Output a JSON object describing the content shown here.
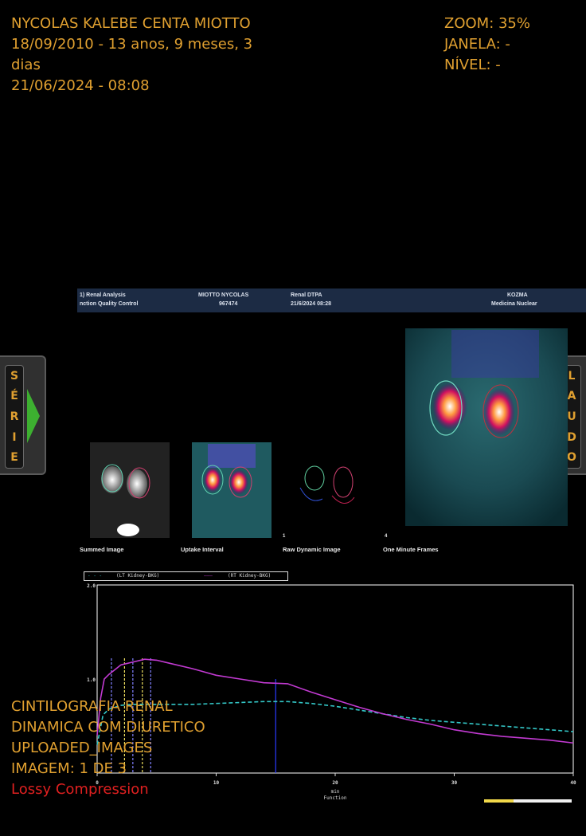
{
  "overlay": {
    "top_left": {
      "name": "NYCOLAS KALEBE CENTA MIOTTO",
      "birth": "18/09/2010 - 13 anos, 9 meses, 3 dias",
      "study_datetime": "21/06/2024 - 08:08"
    },
    "top_right": {
      "zoom": "ZOOM: 35%",
      "window": "JANELA: -",
      "level": "NÍVEL: -"
    },
    "bottom_left": {
      "line1": "CINTILOGRAFIA RENAL",
      "line2": "DINAMICA COM DIURETICO",
      "line3": "UPLOADED_IMAGES",
      "line4": "IMAGEM: 1 DE 3",
      "compression": "Lossy Compression"
    }
  },
  "side_buttons": {
    "left": {
      "letters": [
        "S",
        "É",
        "R",
        "I",
        "E"
      ],
      "icon": "arrow-right-icon"
    },
    "right": {
      "letters": [
        "L",
        "A",
        "U",
        "D",
        "O"
      ],
      "icon": "arrow-left-icon"
    }
  },
  "report": {
    "header": {
      "title1": "1) Renal Analysis",
      "title2": "nction Quality Control",
      "patient": "MIOTTO NYCOLAS",
      "patient_id": "967474",
      "study": "Renal DTPA",
      "study_date": "21/6/2024 08:28",
      "site1": "KOZMA",
      "site2": "Medicina Nuclear"
    },
    "image_labels": {
      "summed": "Summed Image",
      "uptake": "Uptake Interval",
      "raw": "Raw Dynamic Image",
      "minute": "One Minute Frames",
      "raw_index": "1",
      "minute_index": "4"
    },
    "legend": {
      "lt": "(LT Kidney-BKG)",
      "rt": "(RT Kidney-BKG)"
    },
    "colors": {
      "lt": "#33c6c6",
      "rt": "#c23ad2",
      "marker": "#2a3aff",
      "frame": "#ffffff"
    }
  },
  "chart_data": {
    "type": "line",
    "xlabel": "min",
    "xlabel2": "Function",
    "xlim": [
      0,
      40
    ],
    "ylim": [
      0,
      2.0
    ],
    "xticks": [
      "0",
      "10",
      "20",
      "30",
      "40"
    ],
    "yticks": [
      "1.0",
      "2.0"
    ],
    "series": [
      {
        "name": "(LT Kidney-BKG)",
        "style": "dashed",
        "color": "#33c6c6",
        "x": [
          0,
          0.5,
          1,
          2,
          3,
          4,
          5,
          6,
          8,
          10,
          12,
          14,
          16,
          18,
          20,
          22,
          24,
          26,
          28,
          30,
          32,
          34,
          36,
          38,
          40
        ],
        "y": [
          0.3,
          0.62,
          0.68,
          0.72,
          0.73,
          0.73,
          0.73,
          0.73,
          0.73,
          0.74,
          0.75,
          0.76,
          0.76,
          0.74,
          0.71,
          0.67,
          0.63,
          0.59,
          0.56,
          0.54,
          0.52,
          0.5,
          0.48,
          0.46,
          0.44
        ]
      },
      {
        "name": "(RT Kidney-BKG)",
        "style": "solid",
        "color": "#c23ad2",
        "x": [
          0,
          0.3,
          0.6,
          1,
          1.5,
          2,
          3,
          4,
          5,
          6,
          8,
          10,
          12,
          14,
          16,
          18,
          20,
          22,
          24,
          26,
          28,
          30,
          32,
          34,
          36,
          38,
          40
        ],
        "y": [
          0.4,
          0.8,
          1.0,
          1.05,
          1.1,
          1.15,
          1.18,
          1.21,
          1.2,
          1.17,
          1.11,
          1.04,
          1.0,
          0.96,
          0.95,
          0.86,
          0.78,
          0.7,
          0.63,
          0.57,
          0.52,
          0.46,
          0.42,
          0.39,
          0.37,
          0.35,
          0.32
        ]
      }
    ],
    "markers_min": [
      1.2,
      2.3,
      3.0,
      3.8,
      4.5,
      15
    ],
    "grid": false,
    "legend_position": "top-left"
  }
}
